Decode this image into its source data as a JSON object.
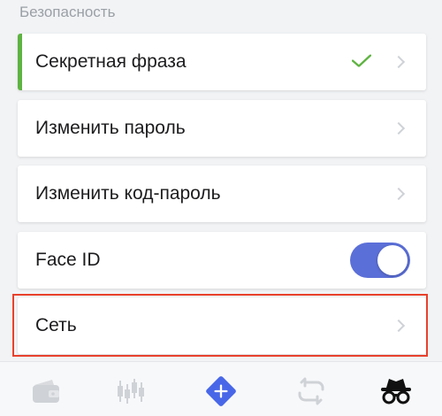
{
  "section": {
    "title": "Безопасность"
  },
  "rows": [
    {
      "label": "Секретная фраза",
      "status": "checked"
    },
    {
      "label": "Изменить пароль"
    },
    {
      "label": "Изменить код-пароль"
    },
    {
      "label": "Face ID",
      "toggle": "on"
    },
    {
      "label": "Сеть"
    }
  ],
  "tabbar": {
    "tabs": [
      {
        "icon": "wallet-icon"
      },
      {
        "icon": "candlestick-chart-icon"
      },
      {
        "icon": "plus-diamond-icon"
      },
      {
        "icon": "swap-icon"
      },
      {
        "icon": "incognito-icon",
        "active": true
      }
    ]
  },
  "colors": {
    "accent_green": "#5fb342",
    "toggle_blue": "#5b6fd8",
    "highlight_red": "#e8412c",
    "add_button": "#4867e8"
  }
}
